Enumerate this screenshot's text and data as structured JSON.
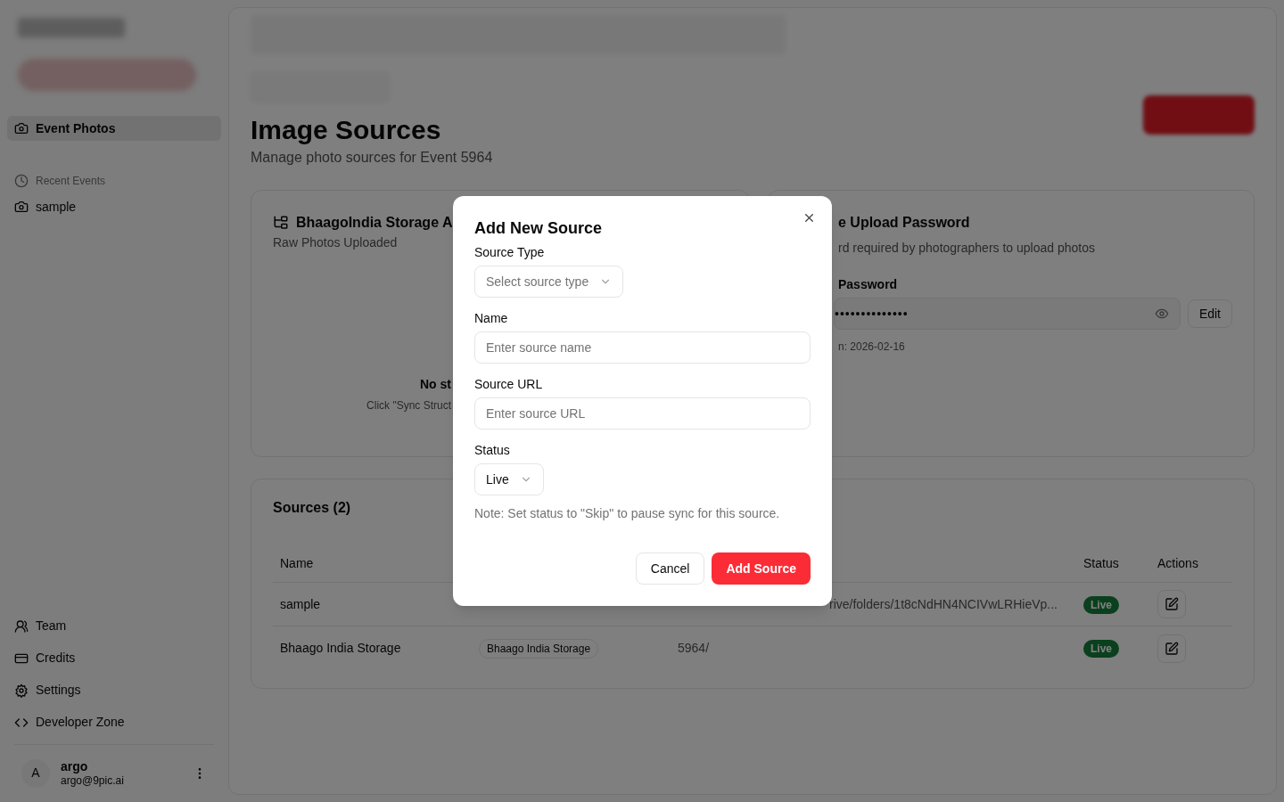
{
  "sidebar": {
    "nav": [
      {
        "label": "Event Photos",
        "selected": true
      }
    ],
    "recent_events": {
      "heading": "Recent Events",
      "items": [
        {
          "label": "sample",
          "selected": false
        }
      ]
    },
    "bottom_items": [
      {
        "label": "Team"
      },
      {
        "label": "Credits"
      },
      {
        "label": "Settings"
      },
      {
        "label": "Developer Zone"
      }
    ],
    "user": {
      "initial": "A",
      "name": "argo",
      "email": "argo@9pic.ai"
    }
  },
  "page": {
    "title": "Image Sources",
    "subtitle": "Manage photo sources for Event 5964"
  },
  "storage_card": {
    "title": "BhaagoIndia Storage A",
    "subtitle": "Raw Photos Uploaded",
    "empty_title": "No st",
    "empty_hint": "Click \"Sync Struct"
  },
  "password_card": {
    "title": "e Upload Password",
    "description": "rd required by photographers to upload photos",
    "field_label": "Password",
    "value": "••••••••••••••",
    "edit_button": "Edit",
    "note": "n: 2026-02-16"
  },
  "sources": {
    "title": "Sources (2)",
    "columns": {
      "name": "Name",
      "status": "Status",
      "actions": "Actions"
    },
    "rows": [
      {
        "name": "sample",
        "url": "rive/folders/1t8cNdHN4NCIVwLRHieVp...",
        "status": "Live"
      },
      {
        "name": "Bhaago India Storage",
        "type": "Bhaago India Storage",
        "url": "5964/",
        "status": "Live"
      }
    ]
  },
  "modal": {
    "title": "Add New Source",
    "fields": [
      {
        "kind": "select",
        "label": "Source Type",
        "placeholder": "Select source type"
      },
      {
        "kind": "text",
        "label": "Name",
        "placeholder": "Enter source name"
      },
      {
        "kind": "text",
        "label": "Source URL",
        "placeholder": "Enter source URL"
      },
      {
        "kind": "select",
        "label": "Status",
        "value": "Live"
      }
    ],
    "note": "Note: Set status to \"Skip\" to pause sync for this source.",
    "cancel_button": "Cancel",
    "submit_button": "Add Source"
  }
}
